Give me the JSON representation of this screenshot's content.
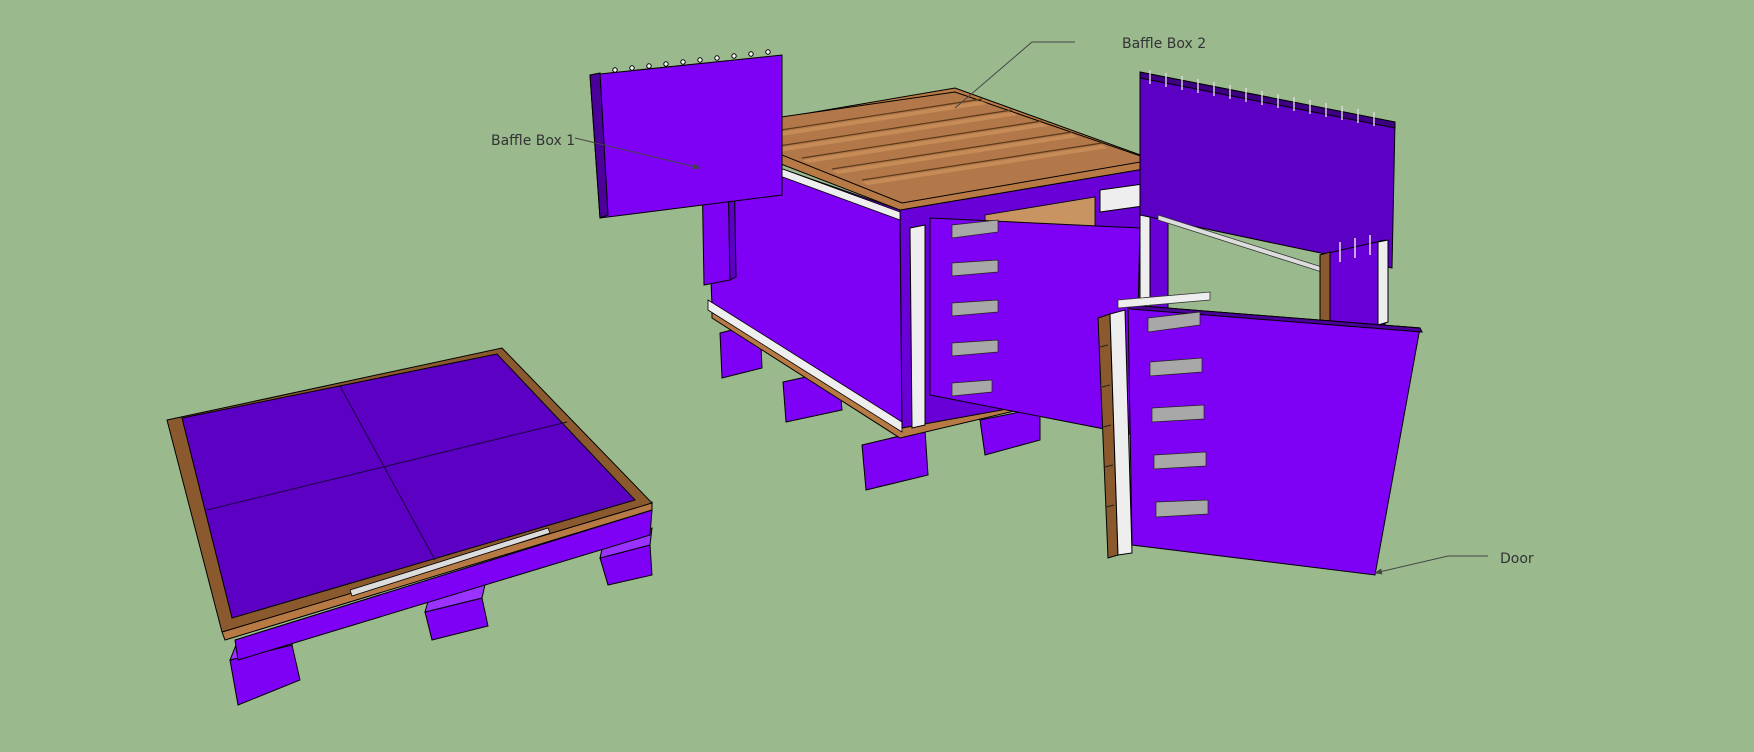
{
  "labels": {
    "baffle_box_1": "Baffle Box 1",
    "baffle_box_2": "Baffle Box 2",
    "door": "Door"
  },
  "colors": {
    "background": "#9aba8e",
    "panel_face": "#7e00f5",
    "panel_dark": "#5c00c4",
    "panel_side": "#6a00d8",
    "wood": "#b87a45",
    "wood_dark": "#8a5a2e",
    "trim": "#eeeeee",
    "hinge": "#a8a8a8",
    "label_text": "#333333",
    "leader_line": "#444444"
  }
}
